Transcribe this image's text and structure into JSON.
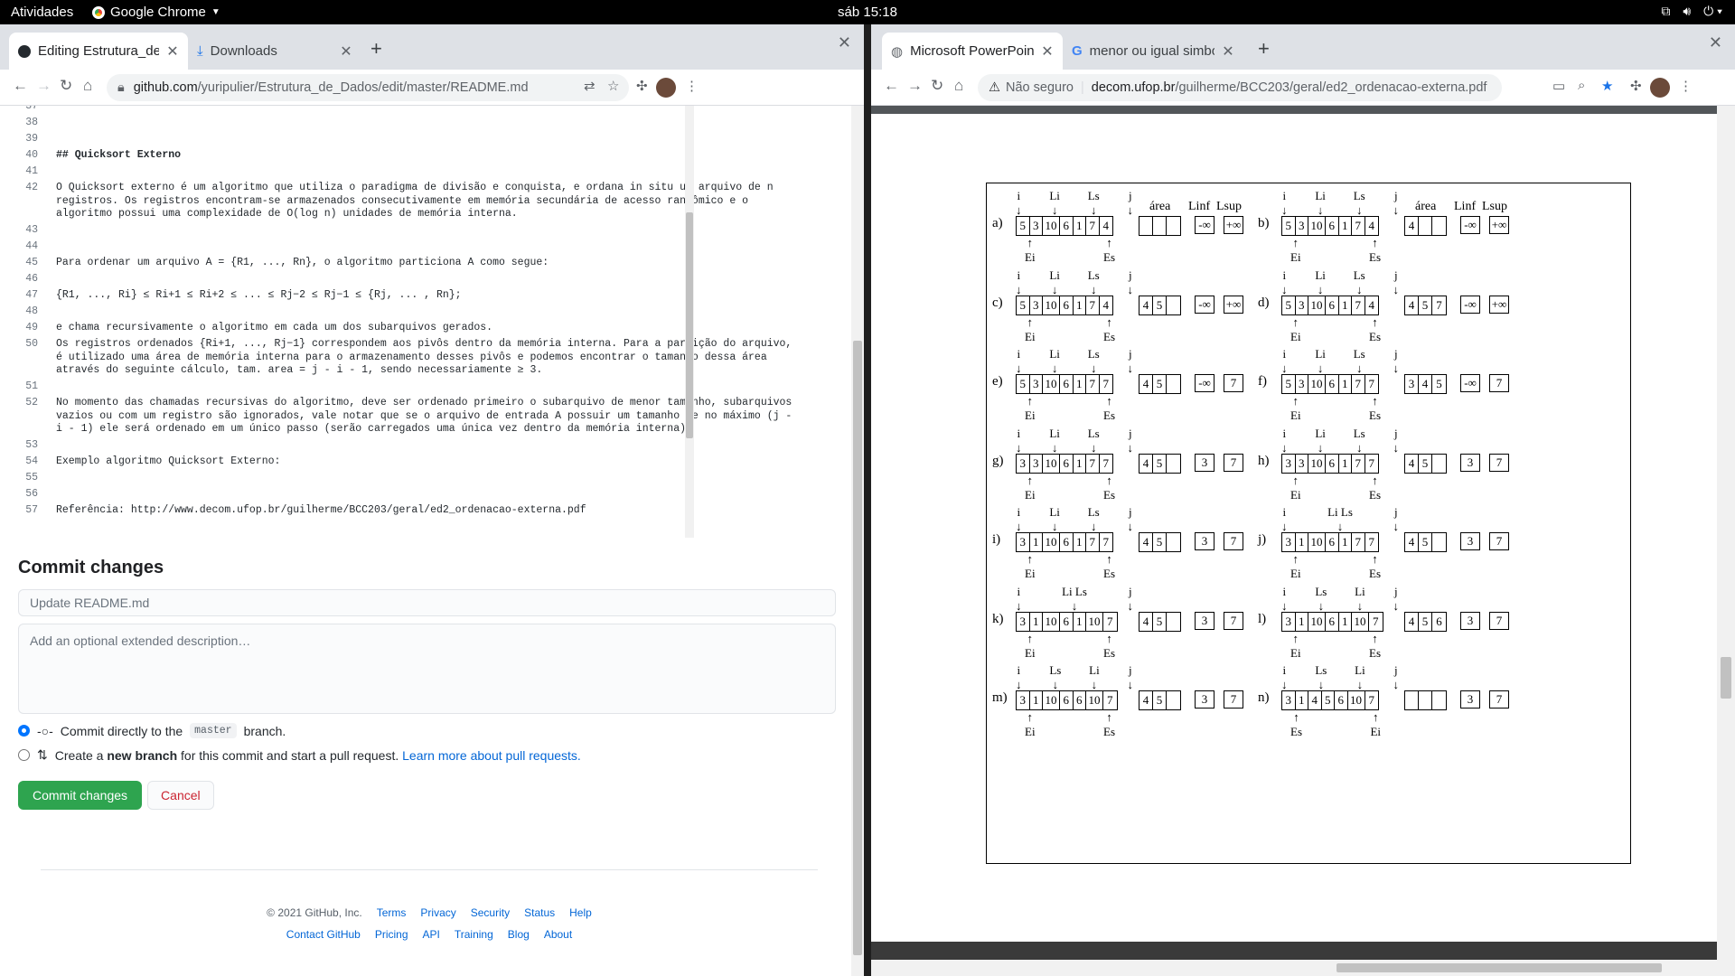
{
  "topbar": {
    "activities": "Atividades",
    "app": "Google Chrome",
    "clock": "sáb 15:18"
  },
  "left": {
    "tabs": [
      {
        "label": "Editing Estrutura_de_Dad",
        "icon": "github-icon"
      },
      {
        "label": "Downloads",
        "icon": "download-icon"
      }
    ],
    "url_host": "github.com",
    "url_path": "/yuripulier/Estrutura_de_Dados/edit/master/README.md",
    "editor_lines": [
      {
        "n": "37",
        "t": ""
      },
      {
        "n": "38",
        "t": ""
      },
      {
        "n": "39",
        "t": ""
      },
      {
        "n": "40",
        "t": "## Quicksort Externo"
      },
      {
        "n": "41",
        "t": ""
      },
      {
        "n": "42",
        "t": "O Quicksort externo é um algoritmo que utiliza o paradigma de divisão e conquista, e ordana in situ um arquivo de n"
      },
      {
        "n": "",
        "t": "registros. Os registros encontram-se armazenados consecutivamente em memória secundária de acesso randômico e o"
      },
      {
        "n": "",
        "t": "algoritmo possui uma complexidade de O(log n) unidades de memória interna."
      },
      {
        "n": "43",
        "t": ""
      },
      {
        "n": "44",
        "t": ""
      },
      {
        "n": "45",
        "t": "Para ordenar um arquivo A = {R1, ..., Rn}, o algoritmo particiona A como segue:"
      },
      {
        "n": "46",
        "t": ""
      },
      {
        "n": "47",
        "t": "{R1, ..., Ri} ≤ Ri+1 ≤ Ri+2 ≤ ... ≤ Rj−2 ≤ Rj−1 ≤ {Rj, ... , Rn};"
      },
      {
        "n": "48",
        "t": ""
      },
      {
        "n": "49",
        "t": "e chama recursivamente o algoritmo em cada um dos subarquivos gerados."
      },
      {
        "n": "50",
        "t": "Os registros ordenados {Ri+1, ..., Rj−1} correspondem aos pivôs dentro da memória interna. Para a partição do arquivo,"
      },
      {
        "n": "",
        "t": "é utilizado uma área de memória interna para o armazenamento desses pivôs e podemos encontrar o tamanho dessa área"
      },
      {
        "n": "",
        "t": "através do seguinte cálculo, tam. area = j - i - 1, sendo necessariamente ≥ 3."
      },
      {
        "n": "51",
        "t": ""
      },
      {
        "n": "52",
        "t": "No momento das chamadas recursivas do algoritmo, deve ser ordenado primeiro o subarquivo de menor tamanho, subarquivos"
      },
      {
        "n": "",
        "t": "vazios ou com um registro são ignorados, vale notar que se o arquivo de entrada A possuir um tamanho de no máximo (j -"
      },
      {
        "n": "",
        "t": "i - 1) ele será ordenado em um único passo (serão carregados uma única vez dentro da memória interna)."
      },
      {
        "n": "53",
        "t": ""
      },
      {
        "n": "54",
        "t": "Exemplo algoritmo Quicksort Externo:"
      },
      {
        "n": "55",
        "t": ""
      },
      {
        "n": "56",
        "t": ""
      },
      {
        "n": "57",
        "t": "Referência: http://www.decom.ufop.br/guilherme/BCC203/geral/ed2_ordenacao-externa.pdf"
      }
    ],
    "commit": {
      "heading": "Commit changes",
      "summary_placeholder": "Update README.md",
      "desc_placeholder": "Add an optional extended description…",
      "opt1_pre": "Commit directly to the",
      "opt1_branch": "master",
      "opt1_post": "branch.",
      "opt2_pre": "Create a",
      "opt2_bold": "new branch",
      "opt2_mid": "for this commit and start a pull request.",
      "opt2_link": "Learn more about pull requests.",
      "commit_btn": "Commit changes",
      "cancel_btn": "Cancel"
    },
    "footer": {
      "copy": "© 2021 GitHub, Inc.",
      "row1": [
        "Terms",
        "Privacy",
        "Security",
        "Status",
        "Help"
      ],
      "row2": [
        "Contact GitHub",
        "Pricing",
        "API",
        "Training",
        "Blog",
        "About"
      ]
    }
  },
  "right": {
    "tabs": [
      {
        "label": "Microsoft PowerPoint - ed",
        "icon": "globe-icon"
      },
      {
        "label": "menor ou igual simbolo - F",
        "icon": "google-icon"
      }
    ],
    "insecure": "Não seguro",
    "url_host": "decom.ufop.br",
    "url_path": "/guilherme/BCC203/geral/ed2_ordenacao-externa.pdf",
    "figure": {
      "headers": {
        "area": "área",
        "linf": "Linf",
        "lsup": "Lsup"
      },
      "panels": [
        {
          "label": "a)",
          "cells": [
            "5",
            "3",
            "10",
            "6",
            "1",
            "7",
            "4"
          ],
          "area": [
            "",
            "",
            ""
          ],
          "linf": "-∞",
          "lsup": "+∞",
          "top": [
            "i",
            "Li",
            "",
            "",
            "",
            "",
            "",
            "Ls",
            "j"
          ],
          "bot": [
            "Ei",
            "Es"
          ]
        },
        {
          "label": "b)",
          "cells": [
            "5",
            "3",
            "10",
            "6",
            "1",
            "7",
            "4"
          ],
          "area": [
            "4",
            "",
            ""
          ],
          "linf": "-∞",
          "lsup": "+∞",
          "top": [
            "i",
            "Li",
            "Ls",
            "j"
          ],
          "bot": [
            "Ei",
            "Es"
          ]
        },
        {
          "label": "c)",
          "cells": [
            "5",
            "3",
            "10",
            "6",
            "1",
            "7",
            "4"
          ],
          "area": [
            "4",
            "5",
            ""
          ],
          "linf": "-∞",
          "lsup": "+∞",
          "top": [
            "i",
            "Li",
            "Ls",
            "j"
          ],
          "bot": [
            "Ei",
            "Es"
          ]
        },
        {
          "label": "d)",
          "cells": [
            "5",
            "3",
            "10",
            "6",
            "1",
            "7",
            "4"
          ],
          "area": [
            "4",
            "5",
            "7"
          ],
          "linf": "-∞",
          "lsup": "+∞",
          "top": [
            "i",
            "Li",
            "Ls",
            "j"
          ],
          "bot": [
            "Ei",
            "Es"
          ]
        },
        {
          "label": "e)",
          "cells": [
            "5",
            "3",
            "10",
            "6",
            "1",
            "7",
            "7"
          ],
          "area": [
            "4",
            "5",
            ""
          ],
          "linf": "-∞",
          "lsup": "7",
          "top": [
            "i",
            "Li",
            "Ls",
            "j"
          ],
          "bot": [
            "Ei",
            "Es"
          ]
        },
        {
          "label": "f)",
          "cells": [
            "5",
            "3",
            "10",
            "6",
            "1",
            "7",
            "7"
          ],
          "area": [
            "3",
            "4",
            "5"
          ],
          "linf": "-∞",
          "lsup": "7",
          "top": [
            "i",
            "Li",
            "Ls",
            "j"
          ],
          "bot": [
            "Ei",
            "Es"
          ]
        },
        {
          "label": "g)",
          "cells": [
            "3",
            "3",
            "10",
            "6",
            "1",
            "7",
            "7"
          ],
          "area": [
            "4",
            "5",
            ""
          ],
          "linf": "3",
          "lsup": "7",
          "top": [
            "i",
            "Li",
            "Ls",
            "j"
          ],
          "bot": [
            "Ei",
            "Es"
          ]
        },
        {
          "label": "h)",
          "cells": [
            "3",
            "3",
            "10",
            "6",
            "1",
            "7",
            "7"
          ],
          "area": [
            "4",
            "5",
            ""
          ],
          "linf": "3",
          "lsup": "7",
          "top": [
            "i",
            "Li",
            "Ls",
            "j"
          ],
          "bot": [
            "Ei",
            "Es"
          ]
        },
        {
          "label": "i)",
          "cells": [
            "3",
            "1",
            "10",
            "6",
            "1",
            "7",
            "7"
          ],
          "area": [
            "4",
            "5",
            ""
          ],
          "linf": "3",
          "lsup": "7",
          "top": [
            "i",
            "Li",
            "Ls",
            "j"
          ],
          "bot": [
            "Ei",
            "Es"
          ]
        },
        {
          "label": "j)",
          "cells": [
            "3",
            "1",
            "10",
            "6",
            "1",
            "7",
            "7"
          ],
          "area": [
            "4",
            "5",
            ""
          ],
          "linf": "3",
          "lsup": "7",
          "top": [
            "i",
            "Li Ls",
            "j"
          ],
          "bot": [
            "Ei",
            "Es"
          ]
        },
        {
          "label": "k)",
          "cells": [
            "3",
            "1",
            "10",
            "6",
            "1",
            "10",
            "7"
          ],
          "area": [
            "4",
            "5",
            ""
          ],
          "linf": "3",
          "lsup": "7",
          "top": [
            "i",
            "Li Ls",
            "j"
          ],
          "bot": [
            "Ei",
            "Es"
          ]
        },
        {
          "label": "l)",
          "cells": [
            "3",
            "1",
            "10",
            "6",
            "1",
            "10",
            "7"
          ],
          "area": [
            "4",
            "5",
            "6"
          ],
          "linf": "3",
          "lsup": "7",
          "top": [
            "i",
            "Ls",
            "Li",
            "j"
          ],
          "bot": [
            "Ei",
            "Es"
          ]
        },
        {
          "label": "m)",
          "cells": [
            "3",
            "1",
            "10",
            "6",
            "6",
            "10",
            "7"
          ],
          "area": [
            "4",
            "5",
            ""
          ],
          "linf": "3",
          "lsup": "7",
          "top": [
            "i",
            "Ls",
            "Li",
            "j"
          ],
          "bot": [
            "Ei",
            "Es"
          ]
        },
        {
          "label": "n)",
          "cells": [
            "3",
            "1",
            "4",
            "5",
            "6",
            "10",
            "7"
          ],
          "area": [
            "",
            "",
            ""
          ],
          "linf": "3",
          "lsup": "7",
          "top": [
            "i",
            "Ls",
            "Li",
            "j"
          ],
          "bot": [
            "Es",
            "Ei"
          ]
        }
      ]
    }
  }
}
